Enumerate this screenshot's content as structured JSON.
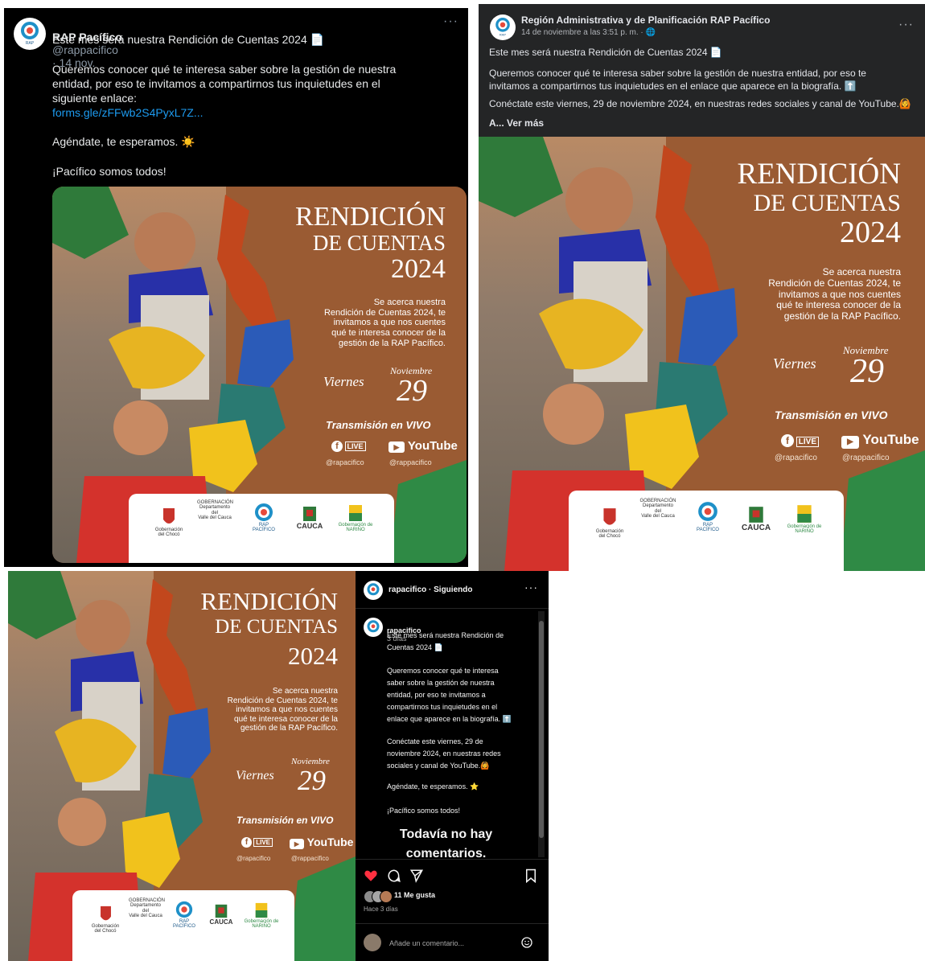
{
  "poster": {
    "title1": "RENDICIÓN",
    "title2": "DE CUENTAS",
    "year": "2024",
    "subtitle": "Se acerca nuestra\nRendición de Cuentas 2024, te\ninvitamos a que nos cuentes\nqué te interesa conocer de la\ngestión de la RAP Pacífico.",
    "day": "Viernes",
    "month": "Noviembre",
    "date_num": "29",
    "live": "Transmisión en VIVO",
    "live_badge": "LIVE",
    "youtube": "YouTube",
    "fb_handle": "@rapacifico",
    "yt_handle": "@rappacifico",
    "logos": [
      {
        "label": "Gobernación\ndel Chocó"
      },
      {
        "label": "GOBERNACIÓN\nDepartamento del\nValle del Cauca"
      },
      {
        "label": "RAP\nPACÍFICO"
      },
      {
        "label": "CAUCA"
      },
      {
        "label": "Gobernación de\nNARIÑO"
      }
    ]
  },
  "twitter": {
    "name": "RAP Pacífico",
    "handle": "@rappacifico",
    "date": "· 14 nov.",
    "line1": "Este mes será nuestra Rendición de Cuentas 2024 📄",
    "body": "Queremos conocer qué te interesa saber sobre la gestión de nuestra\nentidad, por eso te invitamos a compartirnos tus inquietudes en el\nsiguiente enlace:",
    "link": "forms.gle/zFFwb2S4PyxL7Z...",
    "agenda": "Agéndate, te esperamos. ☀️",
    "closing": "¡Pacífico somos todos!",
    "more": "···"
  },
  "facebook": {
    "name": "Región Administrativa y de Planificación RAP Pacífico",
    "date": "14 de noviembre a las 3:51 p. m. · 🌐",
    "line1": "Este mes será nuestra Rendición de Cuentas 2024 📄",
    "line2": "Queremos conocer qué te interesa saber sobre la gestión de nuestra entidad, por eso te\ninvitamos a compartirnos tus inquietudes en el enlace que aparece en la biografía. ⬆️",
    "line3": "Conéctate este viernes, 29 de noviembre 2024, en nuestras redes sociales y canal de YouTube.🙆",
    "more": "A... Ver más",
    "dots": "···"
  },
  "instagram": {
    "header_user": "rapacifico · Siguiendo",
    "user": "rapacifico",
    "time": "3 días",
    "caption1": "Este mes será nuestra Rendición de\nCuentas 2024 📄",
    "caption2": "Queremos conocer qué te interesa\nsaber sobre la gestión de nuestra\nentidad, por eso te invitamos a\ncompartirnos tus inquietudes en el\nenlace que aparece en la biografía. ⬆️",
    "caption3": "Conéctate este viernes, 29 de\nnoviembre 2024, en nuestras redes\nsociales y canal de YouTube.🙆",
    "caption4": "Agéndate, te esperamos. ⭐",
    "caption5": "¡Pacífico somos todos!",
    "no_comments": "Todavía no hay\ncomentarios.",
    "likes": "11 Me gusta",
    "ago": "Hace 3 días",
    "comment_placeholder": "Añade un comentario...",
    "dots": "···"
  }
}
